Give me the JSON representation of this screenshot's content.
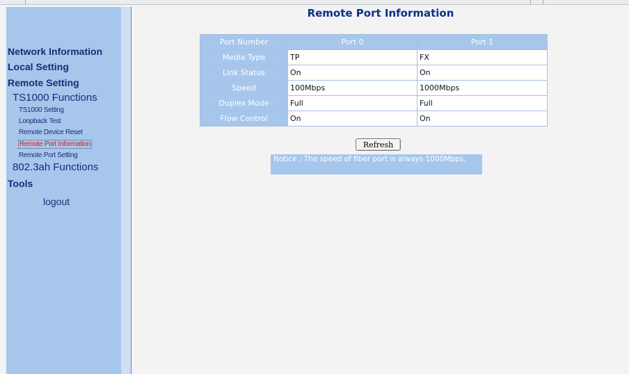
{
  "sidebar": {
    "network_information": "Network Information",
    "local_setting": "Local Setting",
    "remote_setting": "Remote Setting",
    "ts1000_functions": "TS1000 Functions",
    "ts1000_setting": "TS1000 Setting",
    "loopback_test": "Loopback Test",
    "remote_device_reset": "Remote Device Reset",
    "remote_port_information": "Remote Port Information",
    "remote_port_setting": "Remote Port Setting",
    "functions_8023ah": "802.3ah Functions",
    "tools": "Tools",
    "logout": "logout",
    "active_color": "#d61a1a",
    "background_color": "#a6c6ec"
  },
  "main": {
    "title": "Remote Port Information",
    "table": {
      "headers": [
        "Port Number",
        "Port 0",
        "Port 1"
      ],
      "rows": [
        {
          "label": "Media Type",
          "port0": "TP",
          "port1": "FX"
        },
        {
          "label": "Link Status",
          "port0": "On",
          "port1": "On"
        },
        {
          "label": "Speed",
          "port0": "100Mbps",
          "port1": "1000Mbps"
        },
        {
          "label": "Duplex Mode",
          "port0": "Full",
          "port1": "Full"
        },
        {
          "label": "Flow Control",
          "port0": "On",
          "port1": "On"
        }
      ]
    },
    "refresh_label": "Refresh",
    "notice": "Notice : The speed of fiber port is always 1000Mbps."
  }
}
